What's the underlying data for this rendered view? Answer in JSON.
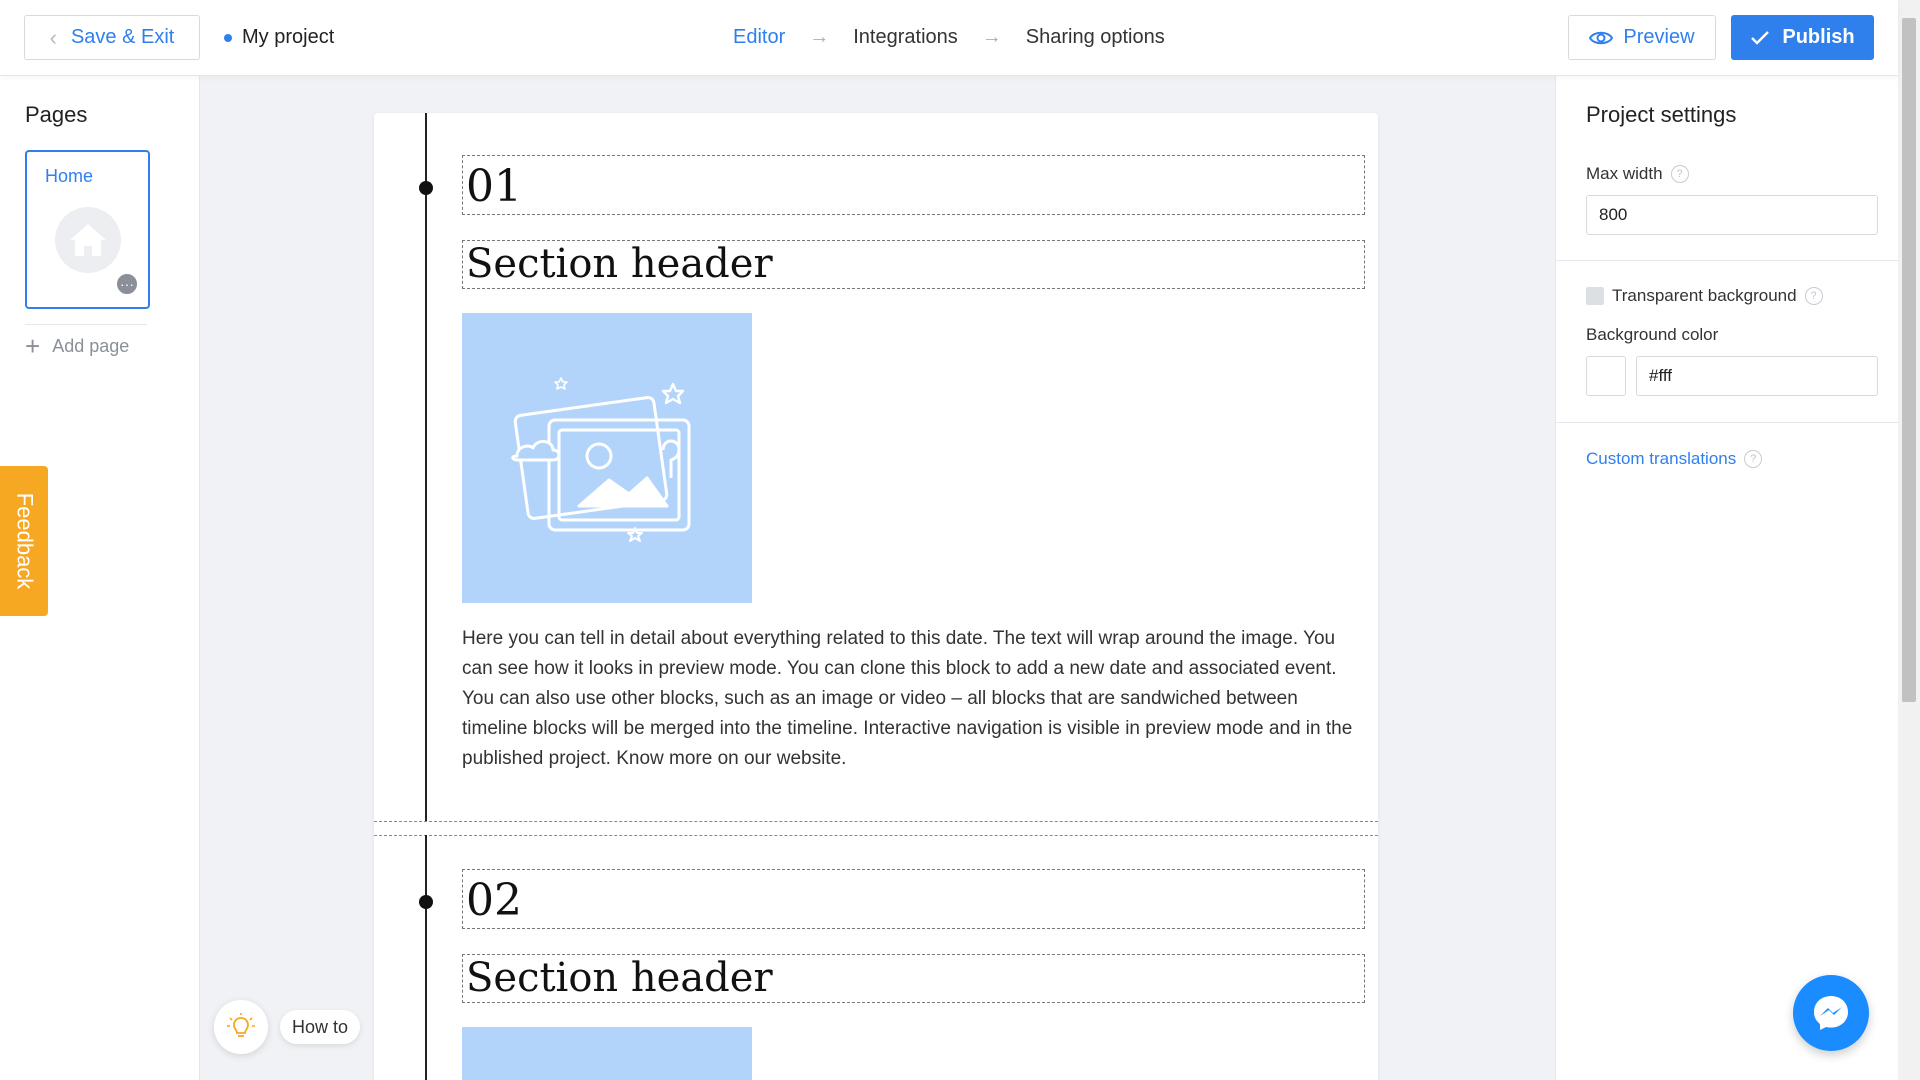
{
  "topbar": {
    "save_exit_label": "Save & Exit",
    "project_name": "My project",
    "steps": [
      {
        "label": "Editor",
        "active": true
      },
      {
        "label": "Integrations",
        "active": false
      },
      {
        "label": "Sharing options",
        "active": false
      }
    ],
    "preview_label": "Preview",
    "publish_label": "Publish"
  },
  "left_sidebar": {
    "title": "Pages",
    "pages": [
      {
        "label": "Home"
      }
    ],
    "add_page_label": "Add page"
  },
  "feedback_label": "Feedback",
  "howto_label": "How to",
  "canvas": {
    "blocks": [
      {
        "date": "01",
        "header": "Section header",
        "text": "Here you can tell in detail about everything related to this date. The text will wrap around the image. You can see how it looks in preview mode. You can clone this block to add a new date and associated event. You can also use other blocks, such as an image or video – all blocks that are sandwiched between timeline blocks will be merged into the timeline. Interactive navigation is visible in preview mode and in the published project. Know more on our website."
      },
      {
        "date": "02",
        "header": "Section header"
      }
    ]
  },
  "right_panel": {
    "title": "Project settings",
    "max_width_label": "Max width",
    "max_width_value": "800",
    "transparent_bg_label": "Transparent background",
    "transparent_bg_checked": false,
    "bg_color_label": "Background color",
    "bg_color_value": "#fff",
    "custom_translations_label": "Custom translations"
  },
  "colors": {
    "accent": "#2f80ed",
    "feedback": "#f7a823",
    "image_placeholder": "#b3d4fa",
    "messenger": "#1a8cff"
  },
  "icons": {
    "back": "chevron-left-icon",
    "preview": "eye-icon",
    "publish": "checkmark-icon",
    "home": "home-icon",
    "more": "more-dots-icon",
    "add": "plus-icon",
    "help": "question-icon",
    "howto": "lightbulb-icon",
    "messenger": "messenger-icon"
  }
}
